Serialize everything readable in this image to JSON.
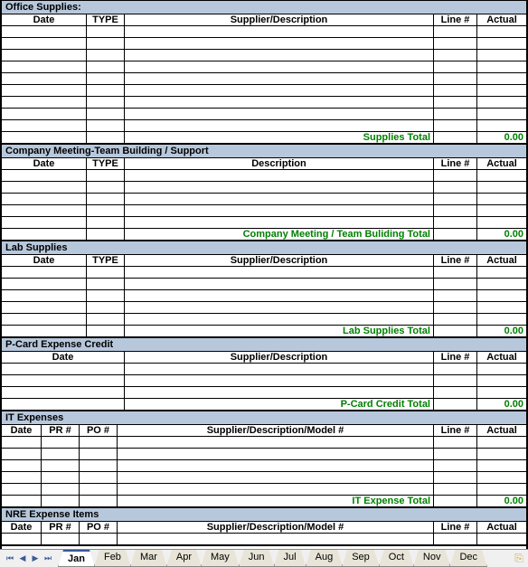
{
  "sections": [
    {
      "title": "Office Supplies:",
      "layout": "l1",
      "headers": [
        "Date",
        "TYPE",
        "Supplier/Description",
        "Line #",
        "Actual"
      ],
      "rows": 9,
      "total_label": "Supplies Total",
      "total_value": "0.00"
    },
    {
      "title": "Company Meeting-Team Building / Support",
      "layout": "l1",
      "headers": [
        "Date",
        "TYPE",
        "Description",
        "Line #",
        "Actual"
      ],
      "rows": 5,
      "total_label": "Company Meeting / Team Buliding Total",
      "total_value": "0.00"
    },
    {
      "title": "Lab Supplies",
      "layout": "l1",
      "headers": [
        "Date",
        "TYPE",
        "Supplier/Description",
        "Line #",
        "Actual"
      ],
      "rows": 5,
      "total_label": "Lab Supplies Total",
      "total_value": "0.00"
    },
    {
      "title": "P-Card Expense Credit",
      "layout": "l2",
      "headers": [
        "Date",
        "Supplier/Description",
        "Line #",
        "Actual"
      ],
      "rows": 3,
      "total_label": "P-Card Credit Total",
      "total_value": "0.00"
    },
    {
      "title": "IT Expenses",
      "layout": "l3",
      "headers": [
        "Date",
        "PR #",
        "PO #",
        "Supplier/Description/Model #",
        "Line #",
        "Actual"
      ],
      "rows": 5,
      "total_label": "IT Expense Total",
      "total_value": "0.00"
    },
    {
      "title": "NRE Expense Items",
      "layout": "l3",
      "headers": [
        "Date",
        "PR #",
        "PO #",
        "Supplier/Description/Model #",
        "Line #",
        "Actual"
      ],
      "rows": 1,
      "total_label": "",
      "total_value": ""
    }
  ],
  "tabs": [
    "Jan",
    "Feb",
    "Mar",
    "Apr",
    "May",
    "Jun",
    "Jul",
    "Aug",
    "Sep",
    "Oct",
    "Nov",
    "Dec"
  ],
  "tab_active": "Jan",
  "nav": {
    "first": "⏮",
    "prev": "◀",
    "next": "▶",
    "last": "⏭"
  }
}
